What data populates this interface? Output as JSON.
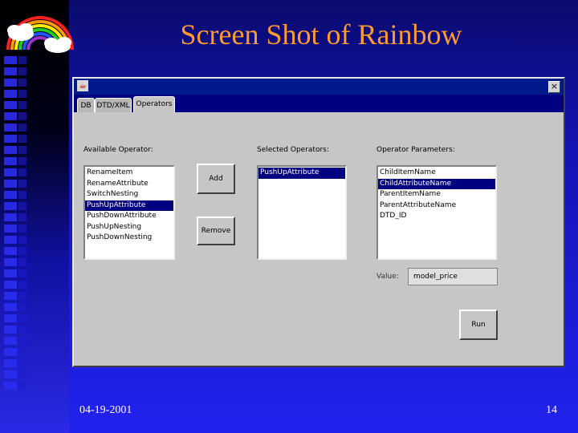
{
  "slide": {
    "title": "Screen Shot of Rainbow",
    "date": "04-19-2001",
    "page_number": "14"
  },
  "app": {
    "tabs": [
      {
        "label": "DB"
      },
      {
        "label": "DTD/XML"
      },
      {
        "label": "Operators"
      }
    ],
    "available_operators": {
      "label": "Available Operator:",
      "items": [
        "RenameItem",
        "RenameAttribute",
        "SwitchNesting",
        "PushUpAttribute",
        "PushDownAttribute",
        "PushUpNesting",
        "PushDownNesting"
      ],
      "selected": "PushUpAttribute"
    },
    "selected_operators": {
      "label": "Selected Operators:",
      "items": [
        "PushUpAttribute"
      ],
      "selected": "PushUpAttribute"
    },
    "operator_parameters": {
      "label": "Operator Parameters:",
      "items": [
        "ChildItemName",
        "ChildAttributeName",
        "ParentItemName",
        "ParentAttributeName",
        "DTD_ID"
      ],
      "selected": "ChildAttributeName"
    },
    "buttons": {
      "add": "Add",
      "remove": "Remove",
      "run": "Run"
    },
    "value": {
      "label": "Value:",
      "text": "model_price"
    },
    "close_glyph": "×",
    "java_glyph": "☕"
  },
  "colors": {
    "title": "#ff9a2e",
    "selection": "#000080",
    "titlebar": "#001a8c"
  }
}
